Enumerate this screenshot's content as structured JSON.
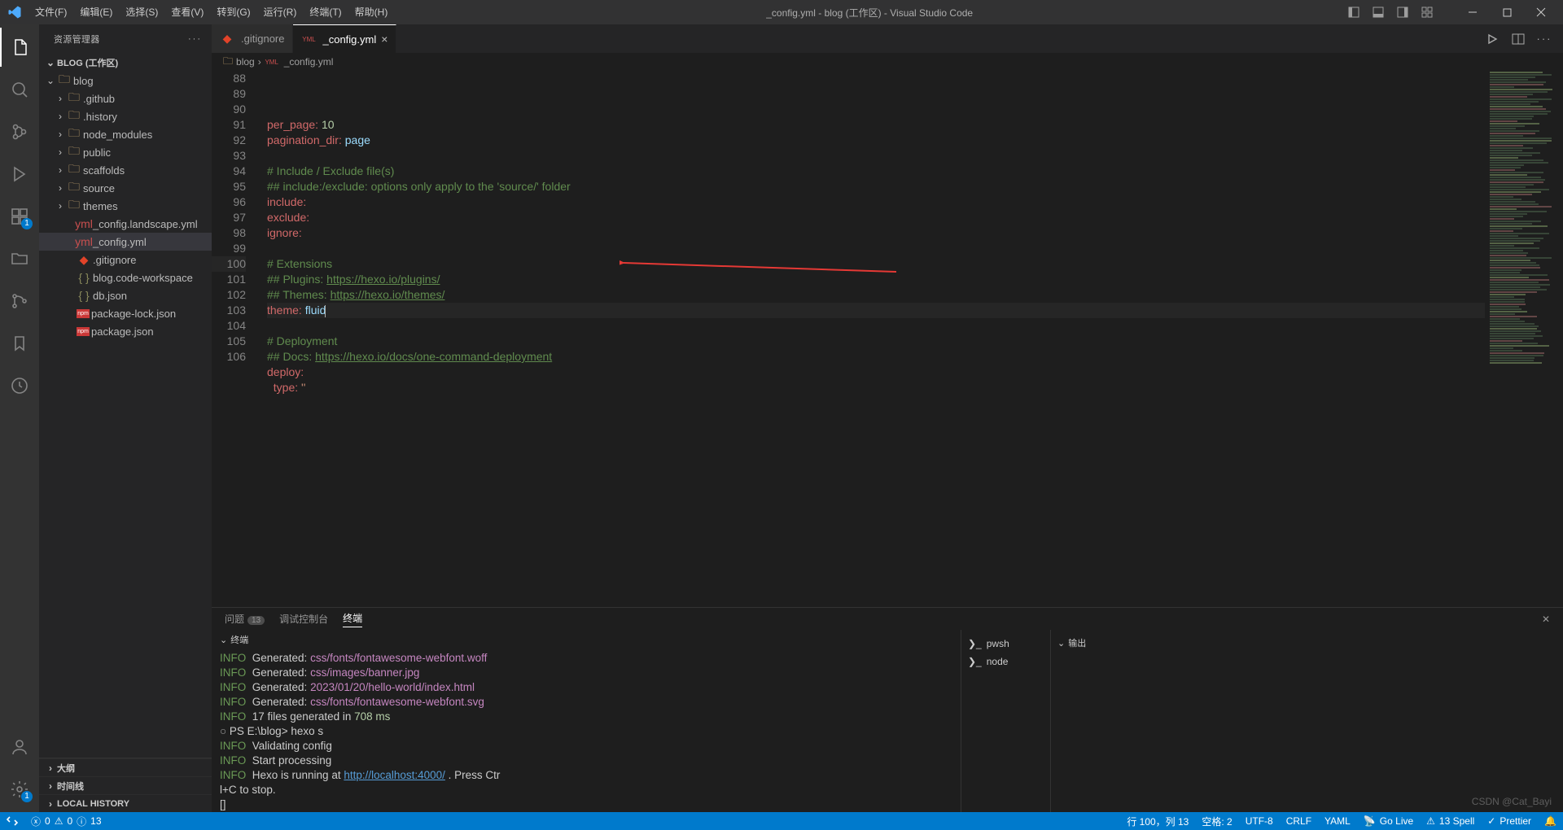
{
  "titlebar": {
    "menu": [
      "文件(F)",
      "编辑(E)",
      "选择(S)",
      "查看(V)",
      "转到(G)",
      "运行(R)",
      "终端(T)",
      "帮助(H)"
    ],
    "title": "_config.yml - blog (工作区) - Visual Studio Code"
  },
  "activity": {
    "items": [
      "explorer",
      "search",
      "source-control",
      "run-debug",
      "extensions",
      "files",
      "git-graph",
      "bookmark",
      "timeline"
    ],
    "ext_badge": "1",
    "settings_badge": "1"
  },
  "sidebar": {
    "header": "资源管理器",
    "root": "BLOG (工作区)",
    "tree": {
      "blog": "blog",
      "folders": [
        ".github",
        ".history",
        "node_modules",
        "public",
        "scaffolds",
        "source",
        "themes"
      ],
      "files": [
        "_config.landscape.yml",
        "_config.yml",
        ".gitignore",
        "blog.code-workspace",
        "db.json",
        "package-lock.json",
        "package.json"
      ]
    },
    "sections": [
      "大纲",
      "时间线",
      "LOCAL HISTORY"
    ],
    "icon_braces": "{ }"
  },
  "tabs": {
    "tab0": {
      "icon": "git-icon",
      "label": ".gitignore"
    },
    "tab1": {
      "icon": "yaml-icon",
      "label": "_config.yml"
    }
  },
  "breadcrumbs": {
    "p0": "blog",
    "p1": "_config.yml"
  },
  "code": {
    "lines": [
      {
        "n": "88",
        "kind": "kv",
        "k": "per_page",
        "v": "10",
        "vtype": "num"
      },
      {
        "n": "89",
        "kind": "kv",
        "k": "pagination_dir",
        "v": "page",
        "vtype": "pl"
      },
      {
        "n": "90",
        "kind": "blank"
      },
      {
        "n": "91",
        "kind": "com",
        "t": "# Include / Exclude file(s)"
      },
      {
        "n": "92",
        "kind": "com",
        "t": "## include:/exclude: options only apply to the 'source/' folder"
      },
      {
        "n": "93",
        "kind": "kv",
        "k": "include",
        "v": "",
        "vtype": "none"
      },
      {
        "n": "94",
        "kind": "kv",
        "k": "exclude",
        "v": "",
        "vtype": "none"
      },
      {
        "n": "95",
        "kind": "kv",
        "k": "ignore",
        "v": "",
        "vtype": "none"
      },
      {
        "n": "96",
        "kind": "blank"
      },
      {
        "n": "97",
        "kind": "com",
        "t": "# Extensions"
      },
      {
        "n": "98",
        "kind": "comlnk",
        "pre": "## Plugins: ",
        "lnk": "https://hexo.io/plugins/"
      },
      {
        "n": "99",
        "kind": "comlnk",
        "pre": "## Themes: ",
        "lnk": "https://hexo.io/themes/"
      },
      {
        "n": "100",
        "kind": "kv",
        "k": "theme",
        "v": "fluid",
        "vtype": "pl",
        "hl": true,
        "cursor": true
      },
      {
        "n": "101",
        "kind": "blank"
      },
      {
        "n": "102",
        "kind": "com",
        "t": "# Deployment"
      },
      {
        "n": "103",
        "kind": "comlnk",
        "pre": "## Docs: ",
        "lnk": "https://hexo.io/docs/one-command-deployment"
      },
      {
        "n": "104",
        "kind": "kv",
        "k": "deploy",
        "v": "",
        "vtype": "none"
      },
      {
        "n": "105",
        "kind": "kvind",
        "k": "type",
        "v": "''",
        "vtype": "str"
      },
      {
        "n": "106",
        "kind": "blank"
      }
    ]
  },
  "panel": {
    "tabs": {
      "problems": "问题",
      "problems_count": "13",
      "debug": "调试控制台",
      "terminal": "终端"
    },
    "term_label": "终端",
    "output_label": "输出",
    "terminals": [
      "pwsh",
      "node"
    ],
    "lines": [
      {
        "t": "info-gen",
        "path": "css/fonts/fontawesome-webfont.woff"
      },
      {
        "t": "info-gen",
        "path": "css/images/banner.jpg"
      },
      {
        "t": "info-gen",
        "path": "2023/01/20/hello-world/index.html"
      },
      {
        "t": "info-gen",
        "path": "css/fonts/fontawesome-webfont.svg"
      },
      {
        "t": "info-files",
        "pre": "17 files generated in ",
        "num": "708 ms"
      },
      {
        "t": "prompt",
        "text": "PS E:\\blog> hexo s"
      },
      {
        "t": "info",
        "text": "Validating config"
      },
      {
        "t": "info",
        "text": "Start processing"
      },
      {
        "t": "info-run",
        "pre": "Hexo is running at ",
        "lnk": "http://localhost:4000/",
        "post": " . Press Ctr"
      },
      {
        "t": "plain",
        "text": "l+C to stop."
      },
      {
        "t": "plain",
        "text": "[]"
      }
    ],
    "info_label": "INFO",
    "generated_label": "Generated:"
  },
  "statusbar": {
    "left": {
      "errors": "0",
      "warnings": "0",
      "infos": "13"
    },
    "right": {
      "pos": "行 100，列 13",
      "spaces": "空格: 2",
      "enc": "UTF-8",
      "eol": "CRLF",
      "lang": "YAML",
      "golive": "Go Live",
      "spell": "13 Spell",
      "prettier": "Prettier",
      "bell": ""
    }
  },
  "watermark": "CSDN @Cat_Bayi"
}
